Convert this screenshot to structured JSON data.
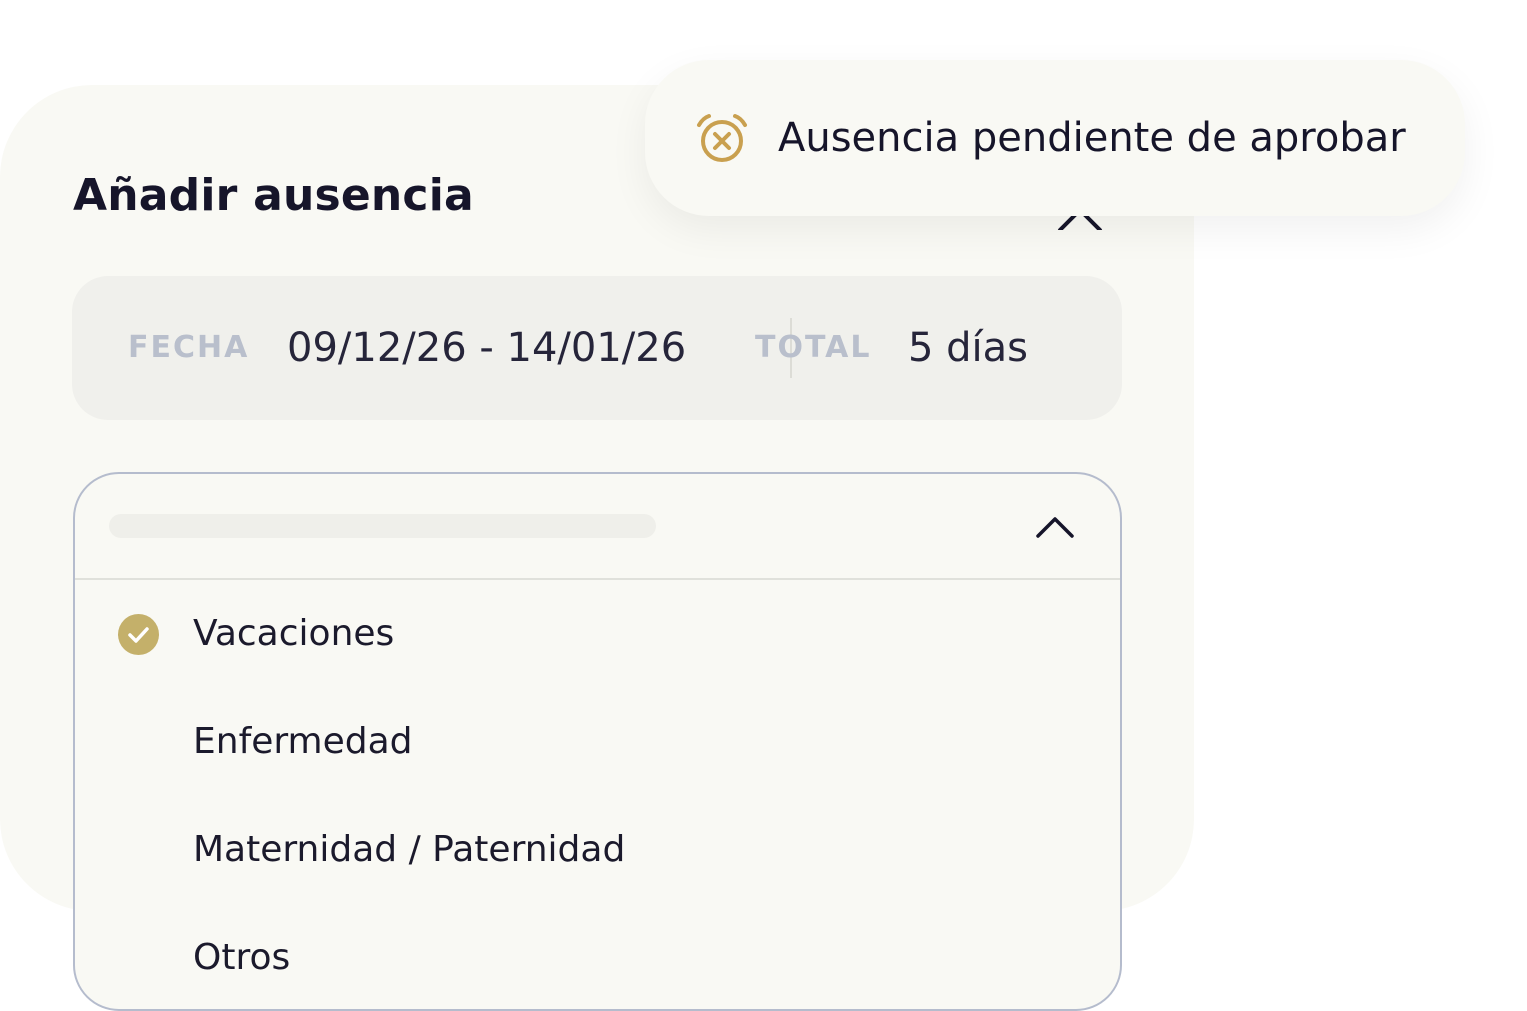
{
  "dialog": {
    "title": "Añadir ausencia"
  },
  "summary": {
    "date_label": "FECHA",
    "date_value": "09/12/26 - 14/01/26",
    "total_label": "TOTAL",
    "total_value": "5 días"
  },
  "dropdown": {
    "state": "open",
    "options": [
      {
        "label": "Vacaciones",
        "selected": true
      },
      {
        "label": "Enfermedad",
        "selected": false
      },
      {
        "label": "Maternidad / Paternidad",
        "selected": false
      },
      {
        "label": "Otros",
        "selected": false
      }
    ]
  },
  "toast": {
    "message": "Ausencia pendiente de aprobar",
    "icon": "alarm-clock-x-icon"
  },
  "colors": {
    "background": "#ffffff",
    "card": "#f9f9f4",
    "summary_bg": "#f0f0ec",
    "accent_gold": "#c4b06a",
    "toast_icon": "#c9a04f",
    "label_gray": "#b9bfcc",
    "border": "#b5bccd",
    "text": "#16152a"
  }
}
